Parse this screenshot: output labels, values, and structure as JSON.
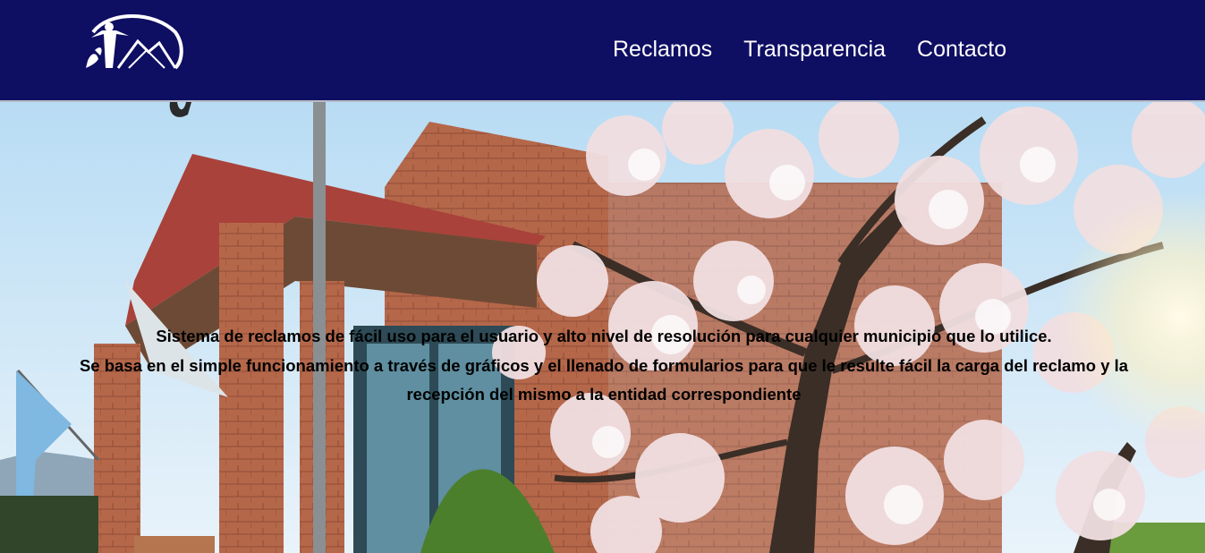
{
  "header": {
    "logo_icon": "municipal-logo-icon",
    "nav": [
      {
        "label": "Reclamos"
      },
      {
        "label": "Transparencia"
      },
      {
        "label": "Contacto"
      }
    ],
    "colors": {
      "background": "#0e0e63",
      "text": "#ffffff"
    }
  },
  "hero": {
    "line1": "Sistema de reclamos de fácil uso para el usuario y alto nivel de resolución para cualquier municipio que lo utilice.",
    "line2": "Se basa en el simple funcionamiento a través de gráficos y el llenado de formularios para que le resulte fácil la carga del reclamo y la recepción del mismo a la entidad correspondiente",
    "image_icon": "town-hall-blossom-photo"
  }
}
